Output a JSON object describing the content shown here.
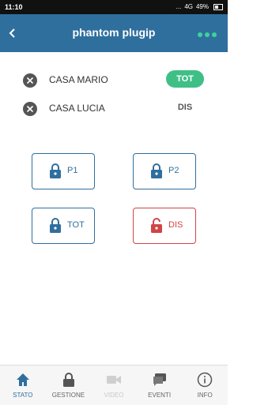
{
  "status_bar": {
    "time": "11:10",
    "indicators": "...",
    "network": "4G",
    "battery": "49%"
  },
  "header": {
    "title": "phantom plugip",
    "back_icon": "chevron-left-icon"
  },
  "zones": [
    {
      "name": "CASA MARIO",
      "state": "TOT",
      "armed": true
    },
    {
      "name": "CASA LUCIA",
      "state": "DIS",
      "armed": false
    }
  ],
  "commands": [
    {
      "label": "P1",
      "icon": "lock-icon",
      "color": "#2f6f9e"
    },
    {
      "label": "P2",
      "icon": "lock-icon",
      "color": "#2f6f9e"
    },
    {
      "label": "TOT",
      "icon": "lock-icon",
      "color": "#2f6f9e"
    },
    {
      "label": "DIS",
      "icon": "unlock-icon",
      "color": "#d14545"
    }
  ],
  "bottom_nav": [
    {
      "label": "STATO",
      "icon": "home-icon",
      "active": true
    },
    {
      "label": "GESTIONE",
      "icon": "lock-icon",
      "active": false
    },
    {
      "label": "VIDEO",
      "icon": "video-icon",
      "disabled": true
    },
    {
      "label": "EVENTI",
      "icon": "chat-icon",
      "active": false
    },
    {
      "label": "INFO",
      "icon": "info-icon",
      "active": false
    }
  ],
  "colors": {
    "primary": "#2f6f9e",
    "accent_green": "#3fbf86",
    "danger": "#d14545"
  }
}
